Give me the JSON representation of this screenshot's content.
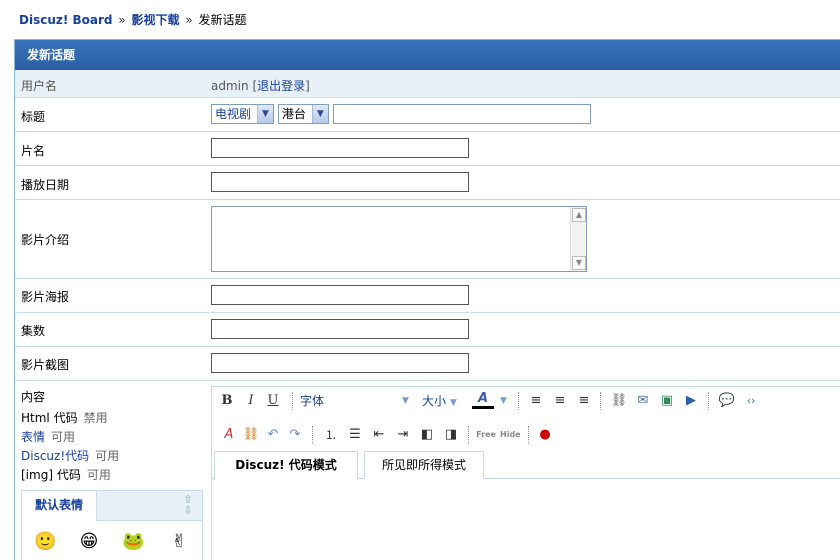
{
  "breadcrumb": {
    "home": "Discuz! Board",
    "forum": "影视下载",
    "current": "发新话题",
    "separator": "»"
  },
  "form": {
    "header": "发新话题",
    "user": {
      "label": "用户名",
      "name": "admin",
      "logout_open": "[",
      "logout": "退出登录",
      "logout_close": "]"
    },
    "title": {
      "label": "标题",
      "type_select": "电视剧",
      "region_select": "港台",
      "value": ""
    },
    "film_name": {
      "label": "片名",
      "value": ""
    },
    "air_date": {
      "label": "播放日期",
      "value": ""
    },
    "intro": {
      "label": "影片介绍",
      "value": ""
    },
    "poster": {
      "label": "影片海报",
      "value": ""
    },
    "episodes": {
      "label": "集数",
      "value": ""
    },
    "screenshot": {
      "label": "影片截图",
      "value": ""
    },
    "content": {
      "label": "内容",
      "rules": [
        {
          "name": "Html 代码",
          "status": "禁用"
        },
        {
          "name": "表情",
          "status": "可用"
        },
        {
          "name": "Discuz!代码",
          "status": "可用"
        },
        {
          "name": "[img] 代码",
          "status": "可用"
        }
      ],
      "smilies_tab": "默认表情"
    }
  },
  "editor": {
    "font_label": "字体",
    "size_label": "大小",
    "mode_code": "Discuz! 代码模式",
    "mode_wysiwyg": "所见即所得模式",
    "toolbar_icons": [
      "bold-icon",
      "italic-icon",
      "underline-icon",
      "font-color-icon",
      "align-left-icon",
      "align-center-icon",
      "align-right-icon",
      "link-icon",
      "email-icon",
      "image-icon",
      "media-icon",
      "quote-icon",
      "code-icon",
      "remove-format-icon",
      "unlink-icon",
      "undo-icon",
      "redo-icon",
      "ordered-list-icon",
      "unordered-list-icon",
      "outdent-icon",
      "indent-icon",
      "float-left-icon",
      "float-right-icon",
      "free-icon",
      "hide-icon",
      "qq-icon"
    ]
  },
  "colors": {
    "header_bg": "#2a5fa4",
    "link": "#16409a",
    "row_border": "#c7dbe8"
  }
}
